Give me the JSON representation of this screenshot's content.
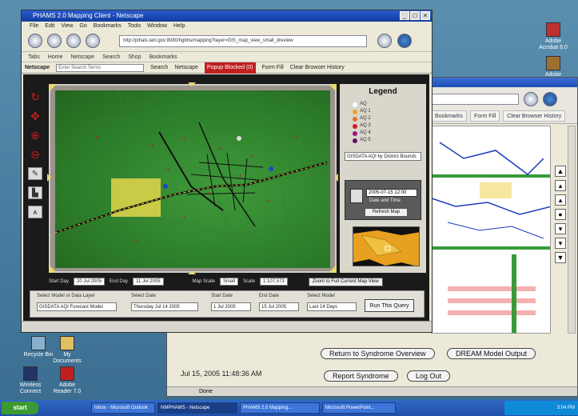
{
  "front_window": {
    "title": "PHAMS 2.0 Mapping Client - Netscape",
    "menu": [
      "File",
      "Edit",
      "View",
      "Go",
      "Bookmarks",
      "Tools",
      "Window",
      "Help"
    ],
    "url": "http://pihals.lanl.gov:8080/hgbhs/mapping?layer=GIS_map_view_small_dreview",
    "bookmarks": [
      "Tabs",
      "Home",
      "Netscape",
      "Search",
      "Shop",
      "Bookmarks"
    ],
    "netscape_label": "Netscape",
    "search_placeholder": "Enter Search Terms",
    "nsbar_items": [
      "Search",
      "Netscape",
      "Popup Blocked (0)",
      "Form Fill",
      "Clear Browser History"
    ]
  },
  "map_panel": {
    "legend_title": "Legend",
    "legend_items": [
      {
        "label": "AQ",
        "color": "#ffffff"
      },
      {
        "label": "AQ 1",
        "color": "#f0a020"
      },
      {
        "label": "AQ 2",
        "color": "#e07030"
      },
      {
        "label": "AQ 3",
        "color": "#d02020"
      },
      {
        "label": "AQ 4",
        "color": "#a01080"
      },
      {
        "label": "AQ 5",
        "color": "#601060"
      }
    ],
    "layer_select": "GISDATA AQI by District Bounds",
    "date_value": "2005-07-15 12:00",
    "data_time_label": "Date and Time",
    "refresh_button": "Refresh Map",
    "zoom_button": "Zoom to Full Current Map View"
  },
  "map_info": {
    "start_label": "Start Day",
    "start_value": "20 Jul 2005",
    "end_label": "End Day",
    "end_value": "11 Jul 2005",
    "map_scale_label": "Map Scale",
    "map_scale_value": "Small",
    "scale_label": "Scale",
    "scale_value": "1:107,573"
  },
  "run_form": {
    "fields": [
      {
        "label": "Select Model or Data Layer",
        "value": "GISDATA AQI Forecast Model"
      },
      {
        "label": "Select Date",
        "value": "Thursday Jul 14 2005"
      },
      {
        "label": "Start Date",
        "value": "1 Jul 2005"
      },
      {
        "label": "End Date",
        "value": "15 Jul 2005"
      },
      {
        "label": "Select Model",
        "value": "Last 14 Days"
      }
    ],
    "run_button": "Run This Query"
  },
  "back_window": {
    "tabs": [
      "Bookmarks",
      "Form Fill",
      "Clear Browser History"
    ],
    "return_button": "Return to Syndrome Overview",
    "dream_button": "DREAM Model Output",
    "timestamp": "Jul 15, 2005 11:48:36 AM",
    "report_button": "Report Syndrome",
    "logout_button": "Log Out",
    "status": "Done"
  },
  "desktop_icons": [
    {
      "label": "Adobe Acrobat 6.0"
    },
    {
      "label": "Adobe Reader"
    },
    {
      "label": "Recycle Bin"
    },
    {
      "label": "My Documents"
    },
    {
      "label": "Wireless Connect"
    },
    {
      "label": "Adobe Reader 7.0"
    }
  ],
  "taskbar": {
    "start": "start",
    "tasks": [
      "Inbox - Microsoft Outlook",
      "NMPHAMS - Netscape",
      "PHAMS 2.0 Mapping...",
      "Microsoft PowerPoint..."
    ],
    "clock": "3:04 PM"
  }
}
